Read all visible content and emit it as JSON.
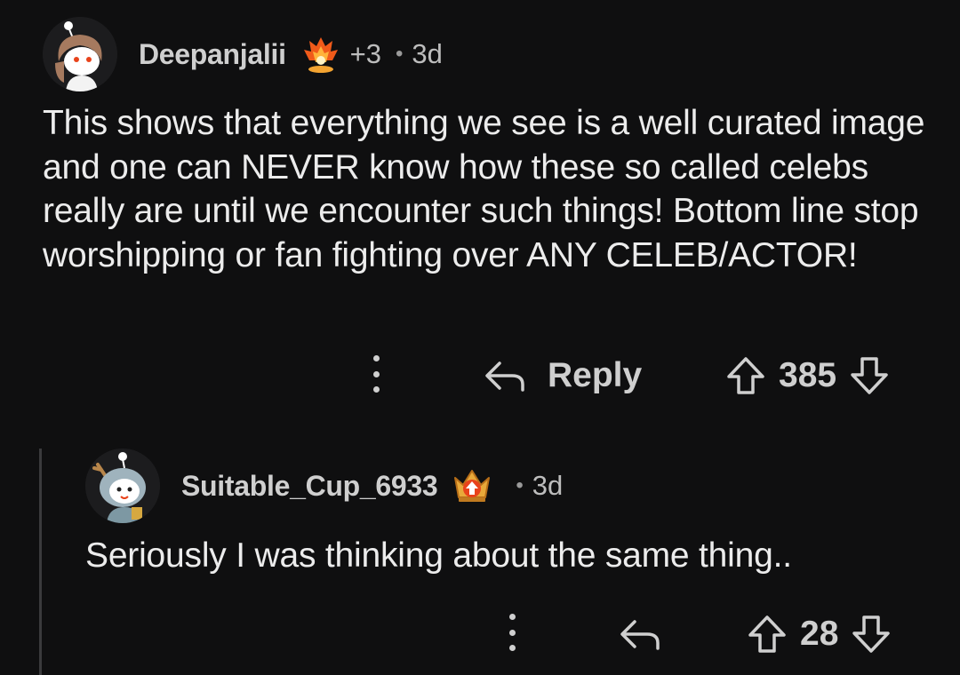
{
  "comments": [
    {
      "username": "Deepanjalii",
      "award_count": "+3",
      "separator": "•",
      "time": "3d",
      "body": "This shows that everything we see is a well curated image and one can NEVER know how these so called celebs really are until we encounter such things! Bottom line stop worshipping or fan fighting over ANY CELEB/ACTOR!",
      "reply_label": "Reply",
      "score": "385"
    },
    {
      "username": "Suitable_Cup_6933",
      "separator": "•",
      "time": "3d",
      "body": "Seriously I was thinking about the same thing..",
      "score": "28"
    }
  ],
  "colors": {
    "background": "#0f0f10",
    "text": "#ececec",
    "muted": "#bdbdbd",
    "thread_line": "#3a3a3c"
  },
  "icons": {
    "more": "kebab-icon",
    "reply": "reply-arrow-icon",
    "upvote": "upvote-arrow-icon",
    "downvote": "downvote-arrow-icon",
    "award1": "fire-award-icon",
    "award2": "upvote-crown-award-icon"
  }
}
